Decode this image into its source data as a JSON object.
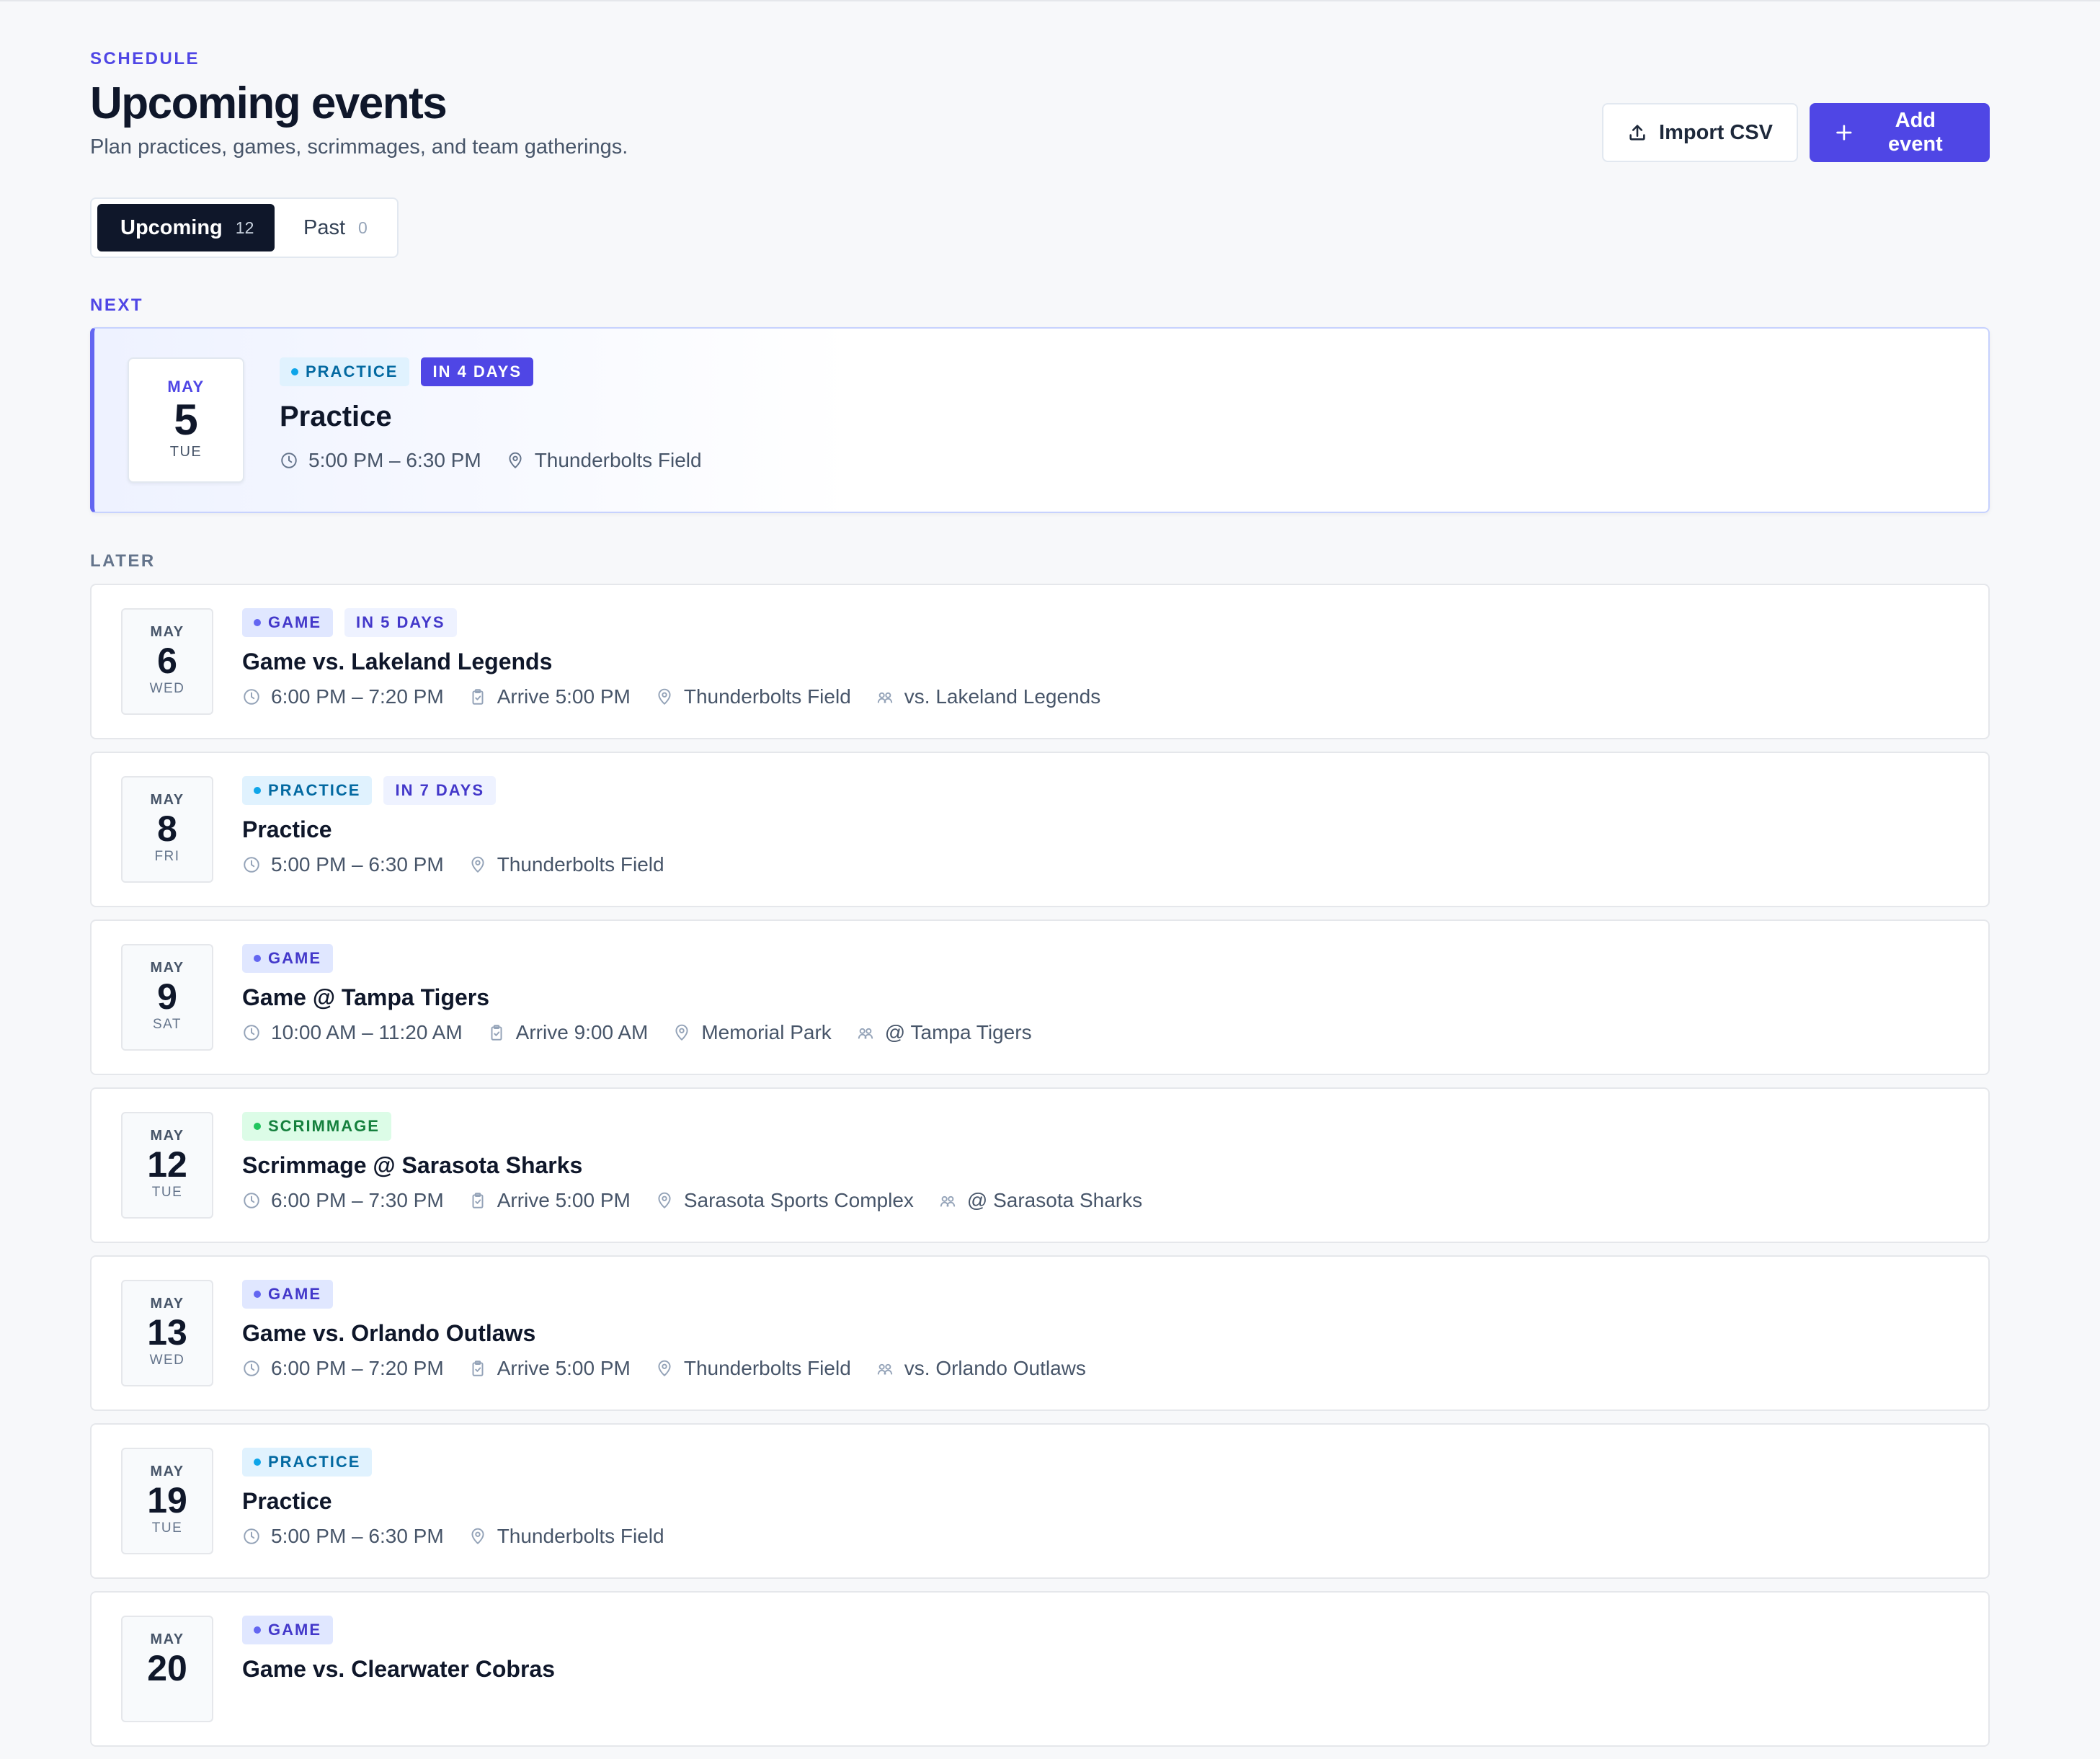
{
  "header": {
    "eyebrow": "SCHEDULE",
    "title": "Upcoming events",
    "subtitle": "Plan practices, games, scrimmages, and team gatherings.",
    "import_label": "Import CSV",
    "add_label": "Add event"
  },
  "tabs": [
    {
      "label": "Upcoming",
      "count": "12"
    },
    {
      "label": "Past",
      "count": "0"
    }
  ],
  "sections": {
    "next": "NEXT",
    "later": "LATER"
  },
  "next_event": {
    "month": "MAY",
    "day": "5",
    "weekday": "TUE",
    "type_label": "PRACTICE",
    "when": "IN 4 DAYS",
    "title": "Practice",
    "time": "5:00 PM – 6:30 PM",
    "location": "Thunderbolts Field"
  },
  "events": [
    {
      "month": "MAY",
      "day": "6",
      "weekday": "WED",
      "type": "game",
      "type_label": "GAME",
      "when": "IN 5 DAYS",
      "title": "Game vs. Lakeland Legends",
      "time": "6:00 PM – 7:20 PM",
      "arrive": "Arrive 5:00 PM",
      "location": "Thunderbolts Field",
      "opponent": "vs. Lakeland Legends"
    },
    {
      "month": "MAY",
      "day": "8",
      "weekday": "FRI",
      "type": "practice",
      "type_label": "PRACTICE",
      "when": "IN 7 DAYS",
      "title": "Practice",
      "time": "5:00 PM – 6:30 PM",
      "arrive": "",
      "location": "Thunderbolts Field",
      "opponent": ""
    },
    {
      "month": "MAY",
      "day": "9",
      "weekday": "SAT",
      "type": "game",
      "type_label": "GAME",
      "when": "",
      "title": "Game @ Tampa Tigers",
      "time": "10:00 AM – 11:20 AM",
      "arrive": "Arrive 9:00 AM",
      "location": "Memorial Park",
      "opponent": "@ Tampa Tigers"
    },
    {
      "month": "MAY",
      "day": "12",
      "weekday": "TUE",
      "type": "scrimmage",
      "type_label": "SCRIMMAGE",
      "when": "",
      "title": "Scrimmage @ Sarasota Sharks",
      "time": "6:00 PM – 7:30 PM",
      "arrive": "Arrive 5:00 PM",
      "location": "Sarasota Sports Complex",
      "opponent": "@ Sarasota Sharks"
    },
    {
      "month": "MAY",
      "day": "13",
      "weekday": "WED",
      "type": "game",
      "type_label": "GAME",
      "when": "",
      "title": "Game vs. Orlando Outlaws",
      "time": "6:00 PM – 7:20 PM",
      "arrive": "Arrive 5:00 PM",
      "location": "Thunderbolts Field",
      "opponent": "vs. Orlando Outlaws"
    },
    {
      "month": "MAY",
      "day": "19",
      "weekday": "TUE",
      "type": "practice",
      "type_label": "PRACTICE",
      "when": "",
      "title": "Practice",
      "time": "5:00 PM – 6:30 PM",
      "arrive": "",
      "location": "Thunderbolts Field",
      "opponent": ""
    },
    {
      "month": "MAY",
      "day": "20",
      "weekday": "",
      "type": "game",
      "type_label": "GAME",
      "when": "",
      "title": "Game vs. Clearwater Cobras",
      "time": "",
      "arrive": "",
      "location": "",
      "opponent": ""
    }
  ],
  "icons": {
    "upload": "upload-icon",
    "plus": "plus-icon",
    "clock": "clock-icon",
    "clipboard": "clipboard-icon",
    "pin": "map-pin-icon",
    "opponent": "users-icon"
  },
  "colors": {
    "accent": "#4f46e5",
    "practice": "#0ea5e9",
    "game": "#6366f1",
    "scrimmage": "#22c55e"
  }
}
